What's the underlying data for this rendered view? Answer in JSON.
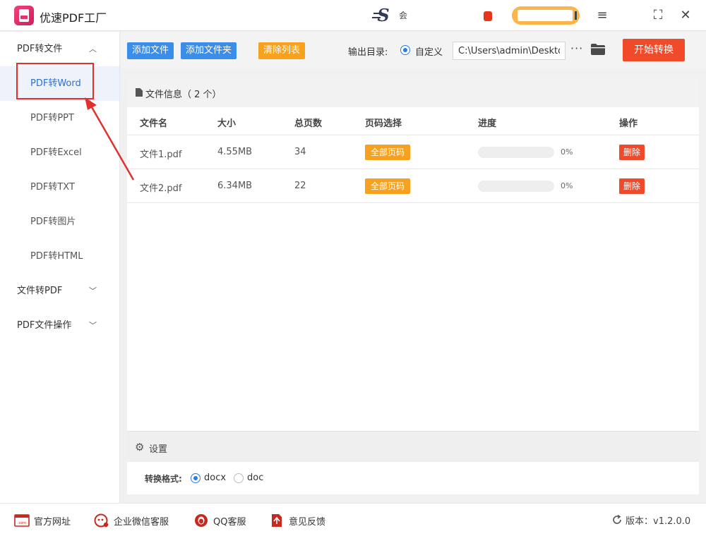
{
  "app": {
    "title": "优速PDF工厂",
    "user_name": "会",
    "colors": {
      "accent_blue": "#3a8de8",
      "accent_orange": "#f7a21e",
      "accent_red": "#ef4b2a",
      "brand_pink": "#e0336c"
    }
  },
  "window_controls": {
    "menu": "≡",
    "maximize": "⛶",
    "close": "✕"
  },
  "sidebar": {
    "groups": [
      {
        "label": "PDF转文件",
        "chevron": "^",
        "expanded": true,
        "items": [
          {
            "label": "PDF转Word",
            "active": true
          },
          {
            "label": "PDF转PPT"
          },
          {
            "label": "PDF转Excel"
          },
          {
            "label": "PDF转TXT"
          },
          {
            "label": "PDF转图片"
          },
          {
            "label": "PDF转HTML"
          }
        ]
      },
      {
        "label": "文件转PDF",
        "chevron": "v",
        "expanded": false
      },
      {
        "label": "PDF文件操作",
        "chevron": "v",
        "expanded": false
      }
    ]
  },
  "toolbar": {
    "add_file": "添加文件",
    "add_folder": "添加文件夹",
    "clear_list": "清除列表",
    "output_label": "输出目录:",
    "output_option": "自定义",
    "output_path": "C:\\Users\\admin\\Desktop",
    "more": "···",
    "start": "开始转换"
  },
  "file_panel": {
    "title": "文件信息（ 2 个）",
    "columns": [
      "文件名",
      "大小",
      "总页数",
      "页码选择",
      "进度",
      "操作"
    ],
    "rows": [
      {
        "name": "文件1.pdf",
        "size": "4.55MB",
        "pages": "34",
        "page_select": "全部页码",
        "progress": 0,
        "progress_text": "0%",
        "action": "删除"
      },
      {
        "name": "文件2.pdf",
        "size": "6.34MB",
        "pages": "22",
        "page_select": "全部页码",
        "progress": 0,
        "progress_text": "0%",
        "action": "删除"
      }
    ]
  },
  "settings": {
    "title": "设置",
    "format_label": "转换格式:",
    "options": [
      {
        "label": "docx",
        "selected": true
      },
      {
        "label": "doc",
        "selected": false
      }
    ]
  },
  "footer": {
    "links": [
      {
        "label": "官方网址",
        "icon": "web-icon"
      },
      {
        "label": "企业微信客服",
        "icon": "wechat-icon"
      },
      {
        "label": "QQ客服",
        "icon": "qq-icon"
      },
      {
        "label": "意见反馈",
        "icon": "feedback-icon"
      }
    ],
    "version": "版本：v1.2.0.0"
  }
}
